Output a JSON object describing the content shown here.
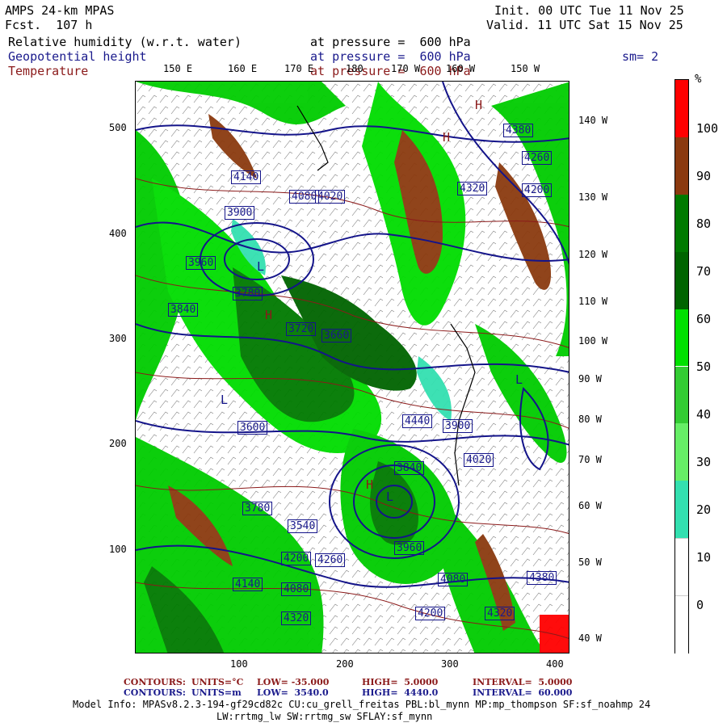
{
  "header": {
    "title": "AMPS 24-km MPAS",
    "fcst": "Fcst.  107 h",
    "init": "Init. 00 UTC Tue 11 Nov 25",
    "valid": "Valid. 11 UTC Sat 15 Nov 25"
  },
  "fields": [
    {
      "name": "Relative humidity (w.r.t. water)",
      "level": "at pressure =  600 hPa",
      "color": "#000000"
    },
    {
      "name": "Geopotential height",
      "level": "at pressure =  600 hPa",
      "color": "#1a1a8c"
    },
    {
      "name": "Temperature",
      "level": "at pressure =  600 hPa",
      "color": "#8b1a1a"
    }
  ],
  "smoothing": "sm= 2",
  "top_lon_labels": [
    "150 E",
    "160 E",
    "170 E",
    "180",
    "170 W",
    "160 W",
    "150 W"
  ],
  "right_lon_labels": [
    "140 W",
    "130 W",
    "120 W",
    "110 W",
    "100 W",
    "90 W",
    "80 W",
    "70 W",
    "60 W",
    "50 W",
    "40 W"
  ],
  "y_ticks": [
    "500",
    "400",
    "300",
    "200",
    "100"
  ],
  "x_ticks": [
    "100",
    "200",
    "300",
    "400"
  ],
  "colorbar": {
    "unit": "%",
    "labels": [
      "100",
      "90",
      "80",
      "70",
      "60",
      "50",
      "40",
      "30",
      "20",
      "10",
      "0"
    ],
    "segments": [
      {
        "from": 90,
        "to": 100,
        "color": "#ff0000"
      },
      {
        "from": 80,
        "to": 90,
        "color": "#8b3a0f"
      },
      {
        "from": 70,
        "to": 80,
        "color": "#007a00"
      },
      {
        "from": 60,
        "to": 70,
        "color": "#006400"
      },
      {
        "from": 50,
        "to": 60,
        "color": "#00e000"
      },
      {
        "from": 40,
        "to": 50,
        "color": "#33cc33"
      },
      {
        "from": 30,
        "to": 40,
        "color": "#66ee66"
      },
      {
        "from": 20,
        "to": 30,
        "color": "#33e0b0"
      },
      {
        "from": 10,
        "to": 20,
        "color": "#ffffff"
      },
      {
        "from": 0,
        "to": 10,
        "color": "#ffffff"
      }
    ]
  },
  "height_labels": [
    "4380",
    "4260",
    "4200",
    "4320",
    "4140",
    "4080",
    "4020",
    "3900",
    "3960",
    "3780",
    "3840",
    "3720",
    "3660",
    "3600",
    "4440",
    "3540",
    "4200",
    "4260",
    "4320",
    "4140",
    "4080",
    "3960",
    "3900",
    "4080",
    "3780",
    "3840",
    "4020",
    "4200",
    "4380",
    "4320"
  ],
  "pressure_highlow": [
    "H",
    "H",
    "L",
    "L",
    "L",
    "H",
    "L",
    "H"
  ],
  "footer": {
    "line1_prefix": "CONTOURS:",
    "line1_units": "UNITS=°C",
    "line1_low": "LOW= -35.000",
    "line1_high": "HIGH=  5.0000",
    "line1_interval": "INTERVAL=  5.0000",
    "line2_prefix": "CONTOURS:",
    "line2_units": "UNITS=m",
    "line2_low": "LOW=  3540.0",
    "line2_high": "HIGH=  4440.0",
    "line2_interval": "INTERVAL=  60.000",
    "model_info": "Model Info: MPASv8.2.3-194-gf29cd82c CU:cu_grell_freitas PBL:bl_mynn MP:mp_thompson SF:sf_noahmp 24",
    "model_info2": "LW:rrtmg_lw SW:rrtmg_sw SFLAY:sf_mynn"
  }
}
